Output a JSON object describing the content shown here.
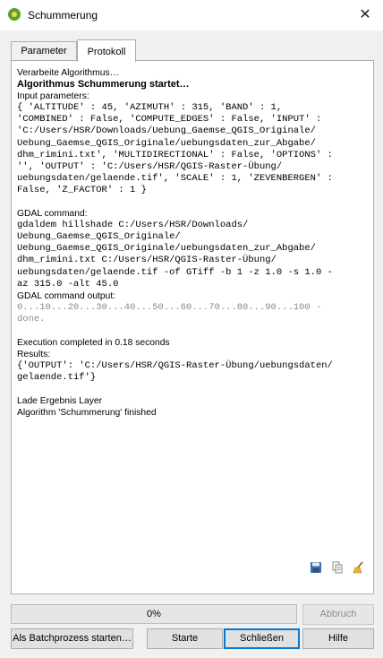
{
  "window": {
    "title": "Schummerung",
    "close_label": "✕"
  },
  "tabs": [
    {
      "label": "Parameter"
    },
    {
      "label": "Protokoll",
      "active": true
    }
  ],
  "log": {
    "lines": [
      {
        "text": "Verarbeite Algorithmus…",
        "style": "normal"
      },
      {
        "text": "Algorithmus Schummerung startet…",
        "style": "bold"
      },
      {
        "text": "Input parameters:",
        "style": "normal"
      },
      {
        "text": "{ 'ALTITUDE' : 45, 'AZIMUTH' : 315, 'BAND' : 1,",
        "style": "mono"
      },
      {
        "text": "'COMBINED' : False, 'COMPUTE_EDGES' : False, 'INPUT' :",
        "style": "mono"
      },
      {
        "text": "'C:/Users/HSR/Downloads/Uebung_Gaemse_QGIS_Originale/",
        "style": "mono"
      },
      {
        "text": "Uebung_Gaemse_QGIS_Originale/uebungsdaten_zur_Abgabe/",
        "style": "mono"
      },
      {
        "text": "dhm_rimini.txt', 'MULTIDIRECTIONAL' : False, 'OPTIONS' :",
        "style": "mono"
      },
      {
        "text": "'', 'OUTPUT' : 'C:/Users/HSR/QGIS-Raster-Übung/",
        "style": "mono"
      },
      {
        "text": "uebungsdaten/gelaende.tif', 'SCALE' : 1, 'ZEVENBERGEN' :",
        "style": "mono"
      },
      {
        "text": "False, 'Z_FACTOR' : 1 }",
        "style": "mono"
      },
      {
        "text": "",
        "style": "gap"
      },
      {
        "text": "GDAL command:",
        "style": "normal"
      },
      {
        "text": "gdaldem hillshade C:/Users/HSR/Downloads/",
        "style": "mono"
      },
      {
        "text": "Uebung_Gaemse_QGIS_Originale/",
        "style": "mono"
      },
      {
        "text": "Uebung_Gaemse_QGIS_Originale/uebungsdaten_zur_Abgabe/",
        "style": "mono"
      },
      {
        "text": "dhm_rimini.txt C:/Users/HSR/QGIS-Raster-Übung/",
        "style": "mono"
      },
      {
        "text": "uebungsdaten/gelaende.tif -of GTiff -b 1 -z 1.0 -s 1.0 -",
        "style": "mono"
      },
      {
        "text": "az 315.0 -alt 45.0",
        "style": "mono"
      },
      {
        "text": "GDAL command output:",
        "style": "normal"
      },
      {
        "text": "0...10...20...30...40...50...60...70...80...90...100 -",
        "style": "mono gray"
      },
      {
        "text": "done.",
        "style": "mono gray"
      },
      {
        "text": "",
        "style": "gap"
      },
      {
        "text": "Execution completed in 0.18 seconds",
        "style": "normal"
      },
      {
        "text": "Results:",
        "style": "normal"
      },
      {
        "text": "{'OUTPUT': 'C:/Users/HSR/QGIS-Raster-Übung/uebungsdaten/",
        "style": "mono"
      },
      {
        "text": "gelaende.tif'}",
        "style": "mono"
      },
      {
        "text": "",
        "style": "gap"
      },
      {
        "text": "Lade Ergebnis Layer",
        "style": "normal"
      },
      {
        "text": "Algorithm 'Schummerung' finished",
        "style": "normal"
      }
    ]
  },
  "toolbar": {
    "save_icon": "save-icon",
    "copy_icon": "copy-icon",
    "clear_icon": "clear-broom-icon"
  },
  "progress": {
    "value": 0,
    "label": "0%"
  },
  "buttons": {
    "cancel": "Abbruch",
    "batch": "Als Batchprozess starten…",
    "run": "Starte",
    "close": "Schließen",
    "help": "Hilfe"
  }
}
